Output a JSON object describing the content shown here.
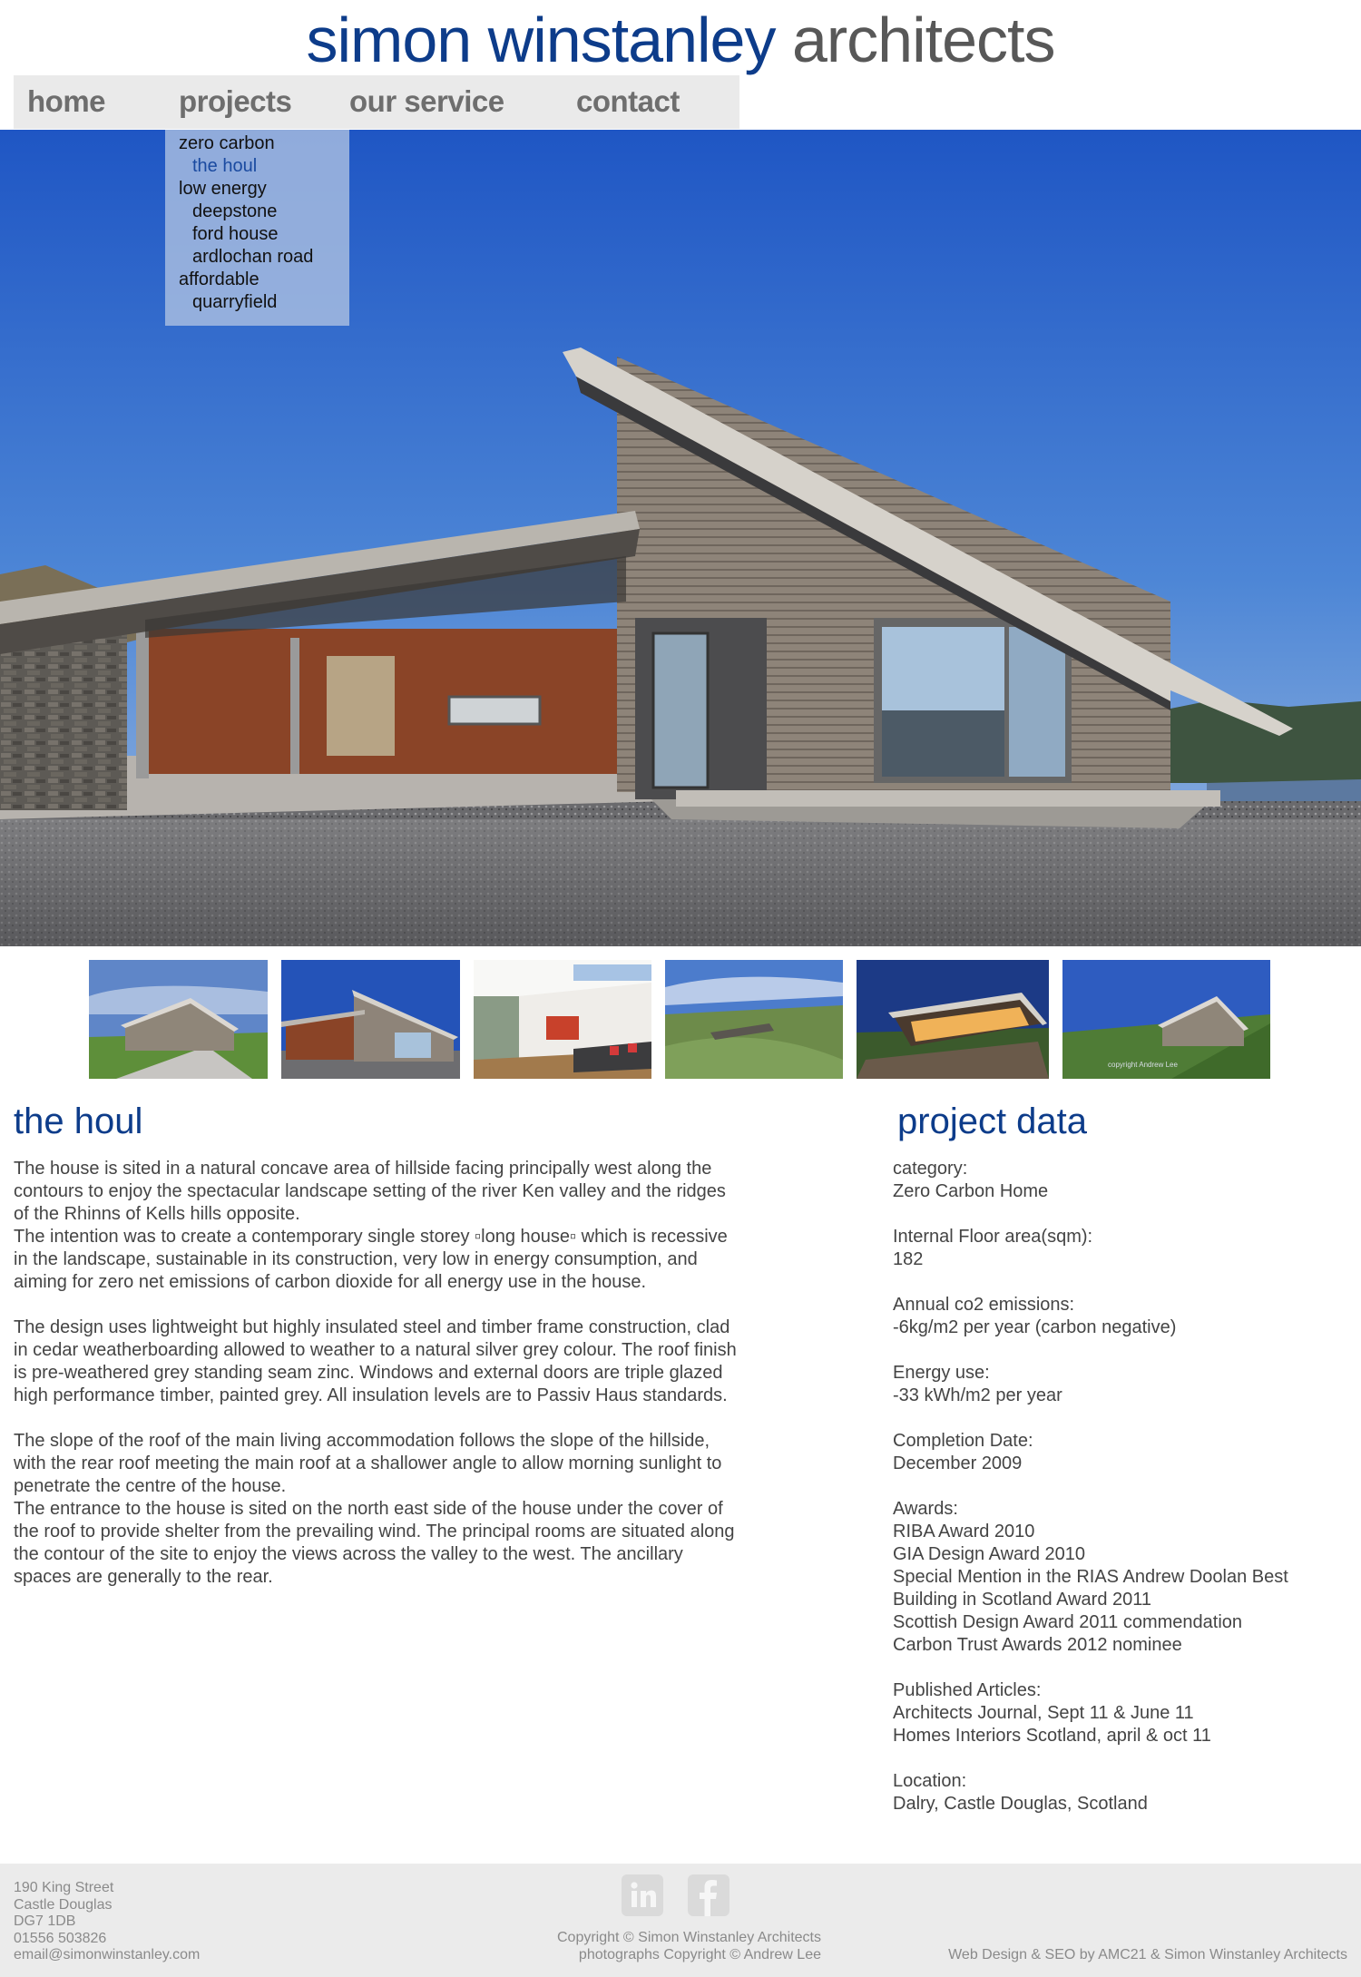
{
  "header": {
    "title_part1": "simon winstanley",
    "title_part2": "architects"
  },
  "nav": {
    "home": "home",
    "projects": "projects",
    "our_service": "our service",
    "contact": "contact"
  },
  "projects_menu": [
    {
      "label": "zero carbon",
      "level": 0
    },
    {
      "label": "the houl",
      "level": 1,
      "active": true
    },
    {
      "label": "low energy",
      "level": 0
    },
    {
      "label": "deepstone",
      "level": 1
    },
    {
      "label": "ford house",
      "level": 1
    },
    {
      "label": "ardlochan road",
      "level": 1
    },
    {
      "label": "affordable",
      "level": 0
    },
    {
      "label": "quarryfield",
      "level": 1
    }
  ],
  "thumbnail_watermark": "copyright Andrew Lee",
  "project": {
    "title": "the houl",
    "paragraphs": [
      "The house is sited in a natural concave area of hillside facing principally west along the contours to enjoy the spectacular landscape setting of the river Ken valley and the ridges of the Rhinns of Kells hills opposite.",
      "The intention was to create a contemporary single storey ▫long house▫ which is recessive in the landscape, sustainable in its construction, very low in energy consumption, and aiming for zero net emissions of carbon dioxide for all energy use in the house.",
      "The design uses lightweight but highly insulated steel and timber frame construction, clad in cedar weatherboarding allowed to weather to a natural silver grey colour. The roof finish is pre-weathered grey standing seam zinc. Windows and external doors are triple glazed high performance timber, painted grey. All insulation levels are to Passiv Haus standards.",
      "The slope of the roof of the main living accommodation follows the slope of the hillside, with the rear roof meeting the main roof at a shallower angle to allow morning sunlight to penetrate the centre of the house.",
      "The entrance to the house is sited on the north east side of the house under the cover of the roof to provide shelter from the prevailing wind. The principal rooms are situated along the contour of the site to enjoy the views across the valley to the west. The ancillary spaces are generally to the rear."
    ]
  },
  "project_data": {
    "title": "project data",
    "groups": [
      {
        "label": "category:",
        "values": [
          "Zero Carbon Home"
        ]
      },
      {
        "label": "Internal Floor area(sqm):",
        "values": [
          "182"
        ]
      },
      {
        "label": "Annual co2 emissions:",
        "values": [
          "-6kg/m2 per year (carbon negative)"
        ]
      },
      {
        "label": "Energy use:",
        "values": [
          "-33  kWh/m2 per year"
        ]
      },
      {
        "label": "Completion Date:",
        "values": [
          "December 2009"
        ]
      },
      {
        "label": "Awards:",
        "values": [
          "RIBA Award 2010",
          "GIA Design Award 2010",
          "Special Mention in the RIAS Andrew Doolan Best",
          "Building in Scotland Award 2011",
          "Scottish Design Award 2011 commendation",
          "Carbon Trust Awards 2012 nominee"
        ]
      },
      {
        "label": "Published Articles:",
        "values": [
          "Architects Journal, Sept 11 & June 11",
          "Homes Interiors Scotland, april & oct 11"
        ]
      },
      {
        "label": "Location:",
        "values": [
          "Dalry, Castle Douglas, Scotland"
        ]
      }
    ]
  },
  "footer": {
    "address": [
      "190 King Street",
      "Castle Douglas",
      "DG7 1DB",
      "01556 503826",
      "email@simonwinstanley.com"
    ],
    "copyright": "Copyright © Simon Winstanley Architects",
    "photo_copyright": "photographs Copyright © Andrew Lee",
    "credit": "Web Design & SEO by AMC21 & Simon Winstanley Architects",
    "social_icons": [
      "linkedin-icon",
      "facebook-icon"
    ]
  }
}
